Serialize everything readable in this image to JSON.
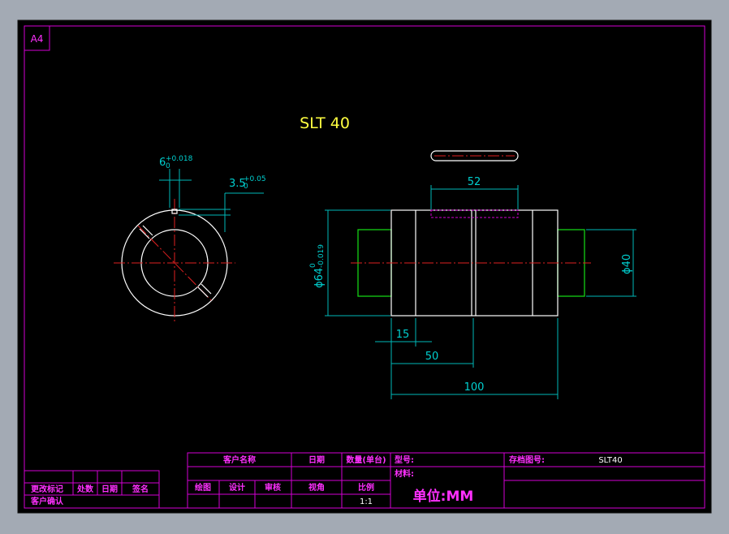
{
  "sheet": {
    "size_label": "A4"
  },
  "drawing": {
    "title": "SLT 40",
    "dimensions": {
      "keyway_width": "6",
      "keyway_width_upper_tol": "+0.018",
      "keyway_width_lower_tol": "0",
      "keyway_depth": "3.5",
      "keyway_depth_upper_tol": "+0.05",
      "keyway_depth_lower_tol": "0",
      "keyway_length": "52",
      "outer_diameter": "ϕ64",
      "outer_diameter_upper_tol": "0",
      "outer_diameter_lower_tol": "-0.019",
      "inner_diameter": "ϕ40",
      "flange_length": "15",
      "half_length": "50",
      "total_length": "100"
    }
  },
  "title_block": {
    "customer_name_label": "客户名称",
    "date_label": "日期",
    "quantity_label": "数量(单台)",
    "model_label": "型号:",
    "archive_no_label": "存档图号:",
    "archive_no_value": "SLT40",
    "material_label": "材料:",
    "drawn_label": "绘图",
    "design_label": "设计",
    "review_label": "审核",
    "view_angle_label": "视角",
    "scale_label": "比例",
    "scale_value": "1:1",
    "unit_label": "单位:MM",
    "revision_mark_label": "更改标记",
    "location_label": "处数",
    "rev_date_label": "日期",
    "signature_label": "签名",
    "customer_confirm_label": "客户确认"
  }
}
